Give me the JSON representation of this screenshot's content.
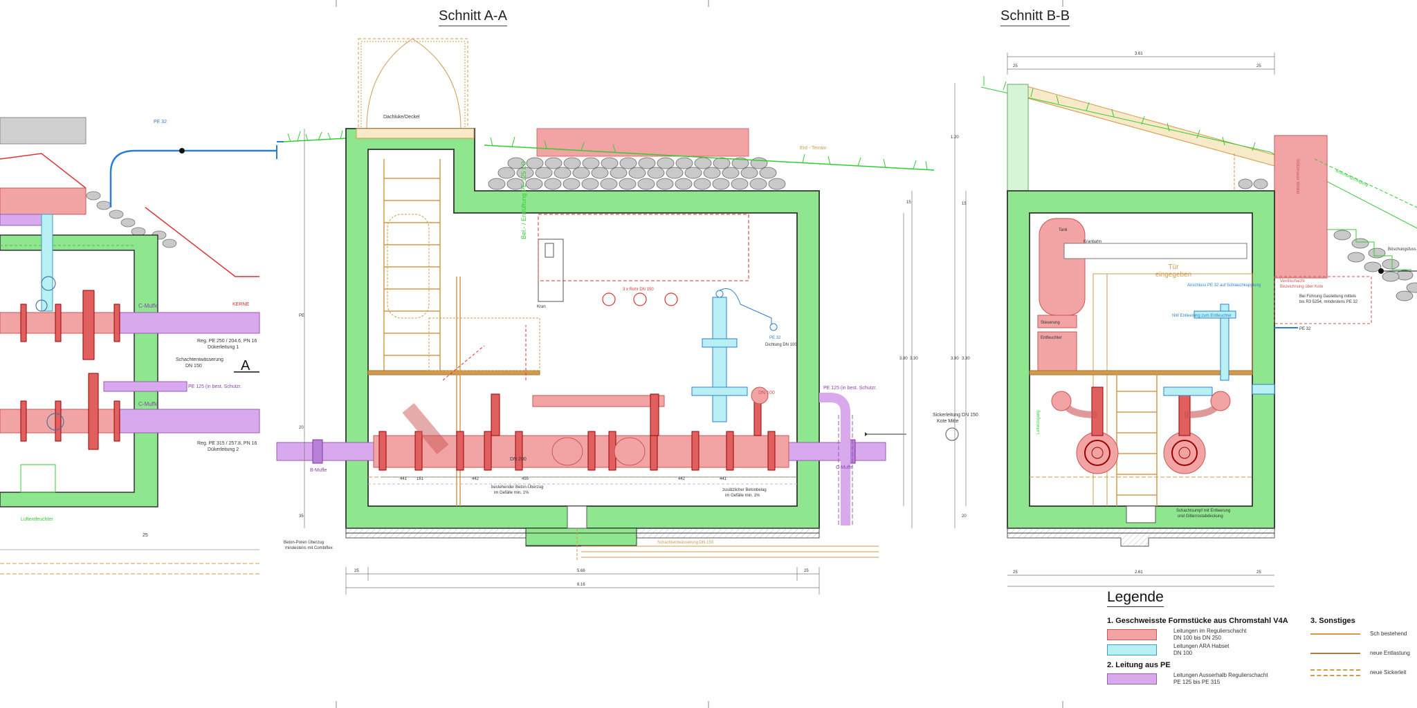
{
  "sections": {
    "a_title": "Schnitt A-A",
    "b_title": "Schnitt B-B",
    "section_marker": "A"
  },
  "plan_labels": {
    "pe_top": "PE 32",
    "c_muffe_1": "C-Muffe",
    "c_muffe_2": "C-Muffe",
    "pipe_1a": "Reg. PE 250 / 204.6, PN 16",
    "pipe_1b": "Dükerleitung 1",
    "pipe_2a": "Reg. PE 315 / 257.8, PN 16",
    "pipe_2b": "Dükerleitung 2",
    "drain": "Schachtentwässerung",
    "drain_dn": "DN 150",
    "pe125": "PE 125 (in best. Schutzr.",
    "dim_25": "25",
    "sump_label": "Luftentfeuchter",
    "kerne": "KERNE"
  },
  "section_a": {
    "hatch_label": "Dachluke/Deckel",
    "soil_label": "Erd - Terrain",
    "vertical_label": "Bel.- / Entlüftung PE 125 LO",
    "crane_box": "Kran",
    "crane_label": "Kranbahn",
    "rings_label": "3 x Rohr DN 150",
    "dn100": "DN 100",
    "dn200": "DN 200",
    "b_muffe": "B-Muffe",
    "c_muffe": "C-Muffe",
    "pe32": "PE 32",
    "dn100_small": "Dichtung DN 100",
    "pe125": "PE 125 (in best. Schutzr.",
    "drain_right_1": "Sickerleitung DN 150",
    "drain_right_2": "Kote Mitte",
    "left_note_1": "Beton-Poren Überzug",
    "left_note_2": "mindestens mit Combiflex",
    "bottom_note_1": "bestehender Beton-Überzug",
    "bottom_note_2": "im Gefälle min. 1%",
    "bottom_note_3": "zusätzlicher Betonbelag",
    "bottom_note_4": "im Gefälle min. 1%",
    "drain_pipe_label": "Schachtentwässerung DN 150",
    "dims": [
      "441",
      "442",
      "442",
      "441",
      "161",
      "455"
    ],
    "dim_total_inner": "5.66",
    "dim_total_outer": "6.16",
    "dim_left": "25",
    "dim_right": "25",
    "dim_h1": "3.30",
    "dim_h2": "3.80",
    "dim_side_a": "20",
    "dim_side_b": "35",
    "dim_v1": "15",
    "dim_v2": "PE"
  },
  "section_b": {
    "dim_top_total": "3.61",
    "dim_top_left": "25",
    "dim_top_right": "25",
    "dim_h_top": "1.20",
    "dim_h_mid": "3.30",
    "dim_h_full": "3.80",
    "dim_v_small": "15",
    "dim_v_bottom": "20",
    "tank_label": "Tank",
    "crane_label": "Kranbahn",
    "door_label_1": "Tür",
    "door_label_2": "eingegeben",
    "box1": "Steuerung",
    "box2": "Entfeuchter",
    "pe32_label": "Anschluss PE 32 auf Schlauchkupplung",
    "dn_label": "NW Entleerung zum Entfeuchter",
    "ventil_label_1": "Ventilschacht",
    "ventil_label_2": "Bezeichnung über Kote",
    "pe_note_1": "Bei Führung Gasleitung mittels",
    "pe_note_2": "bis R3 5254, mindestens PE 32",
    "pe32_right": "PE 32",
    "red_block_label": "Stützmauer Winkel",
    "slope_label": "Böschungsneigung",
    "right_label": "Böschungsfuss",
    "bottom_note_1": "Schachtsumpf mit Entleerung",
    "bottom_note_2": "und Gitterrostabdeckung",
    "dim_bottom_total": "2.61",
    "dim_bottom_left": "25",
    "dim_bottom_right": "25",
    "ladder_label": "Leiterzugang"
  },
  "legend": {
    "title": "Legende",
    "g1_heading": "1. Geschweisste Formstücke aus Chromstahl V4A",
    "g1_item1_l1": "Leitungen im Regulierschacht",
    "g1_item1_l2": "DN 100 bis DN 250",
    "g1_item2_l1": "Leitungen ARA Habset",
    "g1_item2_l2": "DN 100",
    "g2_heading": "2. Leitung aus PE",
    "g2_item1_l1": "Leitungen Ausserhalb Regulierschacht",
    "g2_item1_l2": "PE 125 bis PE 315",
    "g3_heading": "3. Sonstiges",
    "g3_item1": "Sch bestehend",
    "g3_item2": "neue Entlastung",
    "g3_item3": "neue Sickerleit",
    "colors": {
      "red": "#f2a3a3",
      "cyan": "#b8f0f4",
      "purple": "#d9a9ee",
      "orange": "#d29a4a",
      "concrete": "#8ee68e"
    }
  }
}
